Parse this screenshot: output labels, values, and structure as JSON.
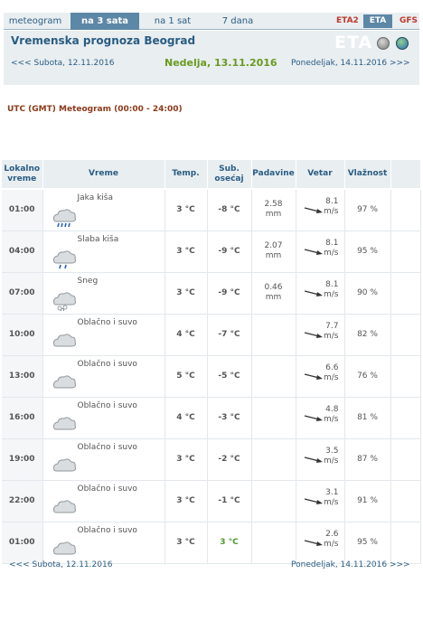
{
  "tabs": [
    {
      "label": "meteogram"
    },
    {
      "label": "na 3 sata"
    },
    {
      "label": "na 1 sat"
    },
    {
      "label": "7 dana"
    }
  ],
  "models": {
    "eta2": "ETA2",
    "eta": "ETA",
    "gfs": "GFS"
  },
  "header": {
    "title": "Vremenska prognoza Beograd",
    "logo": "ETA",
    "prev_day": "<<< Subota, 12.11.2016",
    "current_day": "Nedelja, 13.11.2016",
    "next_day": "Ponedeljak, 14.11.2016 >>>"
  },
  "utc_label": "UTC (GMT) Meteogram (00:00 - 24:00)",
  "table": {
    "columns": {
      "time_line1": "Lokalno",
      "time_line2": "vreme",
      "weather": "Vreme",
      "temp": "Temp.",
      "feels_line1": "Sub.",
      "feels_line2": "osećaj",
      "rain": "Padavine",
      "wind": "Vetar",
      "humidity": "Vlažnost"
    },
    "rows": [
      {
        "time": "01:00",
        "desc": "Jaka kiša",
        "icon": "heavy-rain",
        "temp": "3 °C",
        "feels": "-8 °C",
        "rain_val": "2.58",
        "rain_unit": "mm",
        "wind_val": "8.1",
        "wind_unit": "m/s",
        "hum": "97 %"
      },
      {
        "time": "04:00",
        "desc": "Slaba kiša",
        "icon": "light-rain",
        "temp": "3 °C",
        "feels": "-9 °C",
        "rain_val": "2.07",
        "rain_unit": "mm",
        "wind_val": "8.1",
        "wind_unit": "m/s",
        "hum": "95 %"
      },
      {
        "time": "07:00",
        "desc": "Sneg",
        "icon": "snow",
        "temp": "3 °C",
        "feels": "-9 °C",
        "rain_val": "0.46",
        "rain_unit": "mm",
        "wind_val": "8.1",
        "wind_unit": "m/s",
        "hum": "90 %"
      },
      {
        "time": "10:00",
        "desc": "Oblačno i suvo",
        "icon": "cloud",
        "temp": "4 °C",
        "feels": "-7 °C",
        "rain_val": "",
        "rain_unit": "",
        "wind_val": "7.7",
        "wind_unit": "m/s",
        "hum": "82 %"
      },
      {
        "time": "13:00",
        "desc": "Oblačno i suvo",
        "icon": "cloud",
        "temp": "5 °C",
        "feels": "-5 °C",
        "rain_val": "",
        "rain_unit": "",
        "wind_val": "6.6",
        "wind_unit": "m/s",
        "hum": "76 %"
      },
      {
        "time": "16:00",
        "desc": "Oblačno i suvo",
        "icon": "cloud",
        "temp": "4 °C",
        "feels": "-3 °C",
        "rain_val": "",
        "rain_unit": "",
        "wind_val": "4.8",
        "wind_unit": "m/s",
        "hum": "81 %"
      },
      {
        "time": "19:00",
        "desc": "Oblačno i suvo",
        "icon": "cloud",
        "temp": "3 °C",
        "feels": "-2 °C",
        "rain_val": "",
        "rain_unit": "",
        "wind_val": "3.5",
        "wind_unit": "m/s",
        "hum": "87 %"
      },
      {
        "time": "22:00",
        "desc": "Oblačno i suvo",
        "icon": "cloud",
        "temp": "3 °C",
        "feels": "-1 °C",
        "rain_val": "",
        "rain_unit": "",
        "wind_val": "3.1",
        "wind_unit": "m/s",
        "hum": "91 %"
      },
      {
        "time": "01:00",
        "desc": "Oblačno i suvo",
        "icon": "cloud",
        "temp": "3 °C",
        "feels": "3 °C",
        "rain_val": "",
        "rain_unit": "",
        "wind_val": "2.6",
        "wind_unit": "m/s",
        "hum": "95 %"
      }
    ]
  },
  "footer": {
    "prev_day": "<<< Subota, 12.11.2016",
    "next_day": "Ponedeljak, 14.11.2016 >>>"
  },
  "colors": {
    "accent": "#5d87a6",
    "title": "#2a5c82",
    "current_day": "#6a9a1f",
    "temp": "#4a9a2c",
    "model_red": "#c0392b",
    "panel_bg": "#e9eef1"
  }
}
